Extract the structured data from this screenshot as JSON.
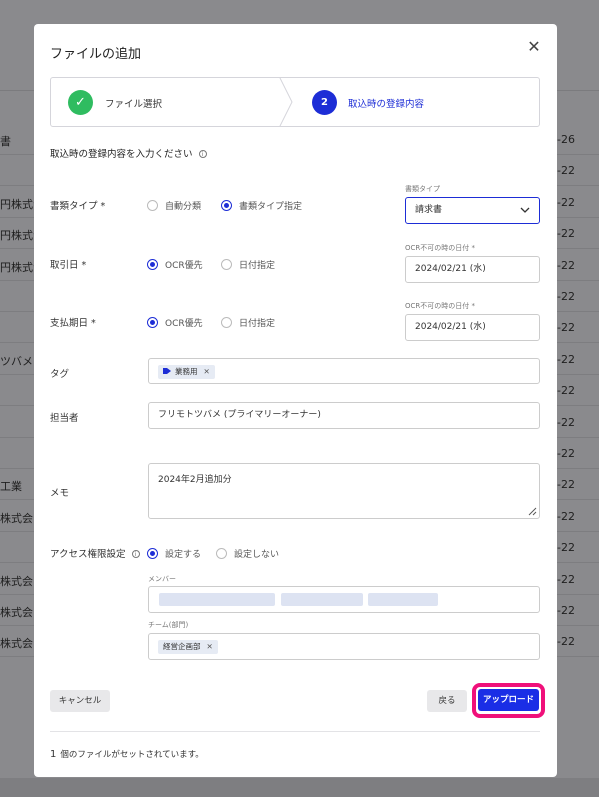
{
  "background": {
    "rows": [
      {
        "left": "書",
        "right": "-26"
      },
      {
        "left": "",
        "right": "-22"
      },
      {
        "left": "円株式会",
        "right": "-22"
      },
      {
        "left": "円株式会",
        "right": "-22"
      },
      {
        "left": "円株式会",
        "right": "-22"
      },
      {
        "left": "",
        "right": "-22"
      },
      {
        "left": "",
        "right": "-22"
      },
      {
        "left": "ツバメ",
        "right": "-22"
      },
      {
        "left": "",
        "right": "-22"
      },
      {
        "left": "",
        "right": "-22"
      },
      {
        "left": "",
        "right": "-22"
      },
      {
        "left": "工業",
        "right": "-22"
      },
      {
        "left": "株式会",
        "right": "-22"
      },
      {
        "left": "",
        "right": "-22"
      },
      {
        "left": "株式会",
        "right": "-22"
      },
      {
        "left": "株式会",
        "right": "-22"
      },
      {
        "left": "株式会",
        "right": "-22"
      }
    ]
  },
  "modal": {
    "title": "ファイルの追加",
    "close_icon": "close-icon",
    "steps": [
      {
        "label": "ファイル選択",
        "state": "done"
      },
      {
        "number": "2",
        "label": "取込時の登録内容",
        "state": "active"
      }
    ],
    "section_title": "取込時の登録内容を入力ください",
    "doc_type": {
      "label": "書類タイプ *",
      "options": [
        "自動分類",
        "書類タイプ指定"
      ],
      "selected": 1,
      "select_label": "書類タイプ",
      "select_value": "請求書"
    },
    "transaction_date": {
      "label": "取引日 *",
      "options": [
        "OCR優先",
        "日付指定"
      ],
      "selected": 0,
      "fallback_label": "OCR不可の時の日付 *",
      "fallback_value": "2024/02/21 (水)"
    },
    "due_date": {
      "label": "支払期日 *",
      "options": [
        "OCR優先",
        "日付指定"
      ],
      "selected": 0,
      "fallback_label": "OCR不可の時の日付 *",
      "fallback_value": "2024/02/21 (水)"
    },
    "tag": {
      "label": "タグ",
      "chip": "業務用"
    },
    "assignee": {
      "label": "担当者",
      "value": "フリモトツバメ (プライマリーオーナー)"
    },
    "memo": {
      "label": "メモ",
      "value": "2024年2月追加分"
    },
    "access": {
      "label": "アクセス権限設定",
      "options": [
        "設定する",
        "設定しない"
      ],
      "selected": 0,
      "members_label": "メンバー",
      "team_label": "チーム(部門)",
      "team_chip": "経営企画部"
    },
    "buttons": {
      "cancel": "キャンセル",
      "back": "戻る",
      "upload": "アップロード"
    },
    "footer": {
      "count": "1",
      "text": "個のファイルがセットされています。"
    },
    "colors": {
      "primary": "#1a2ee6",
      "success": "#2fbc60",
      "highlight": "#f0107a"
    }
  }
}
